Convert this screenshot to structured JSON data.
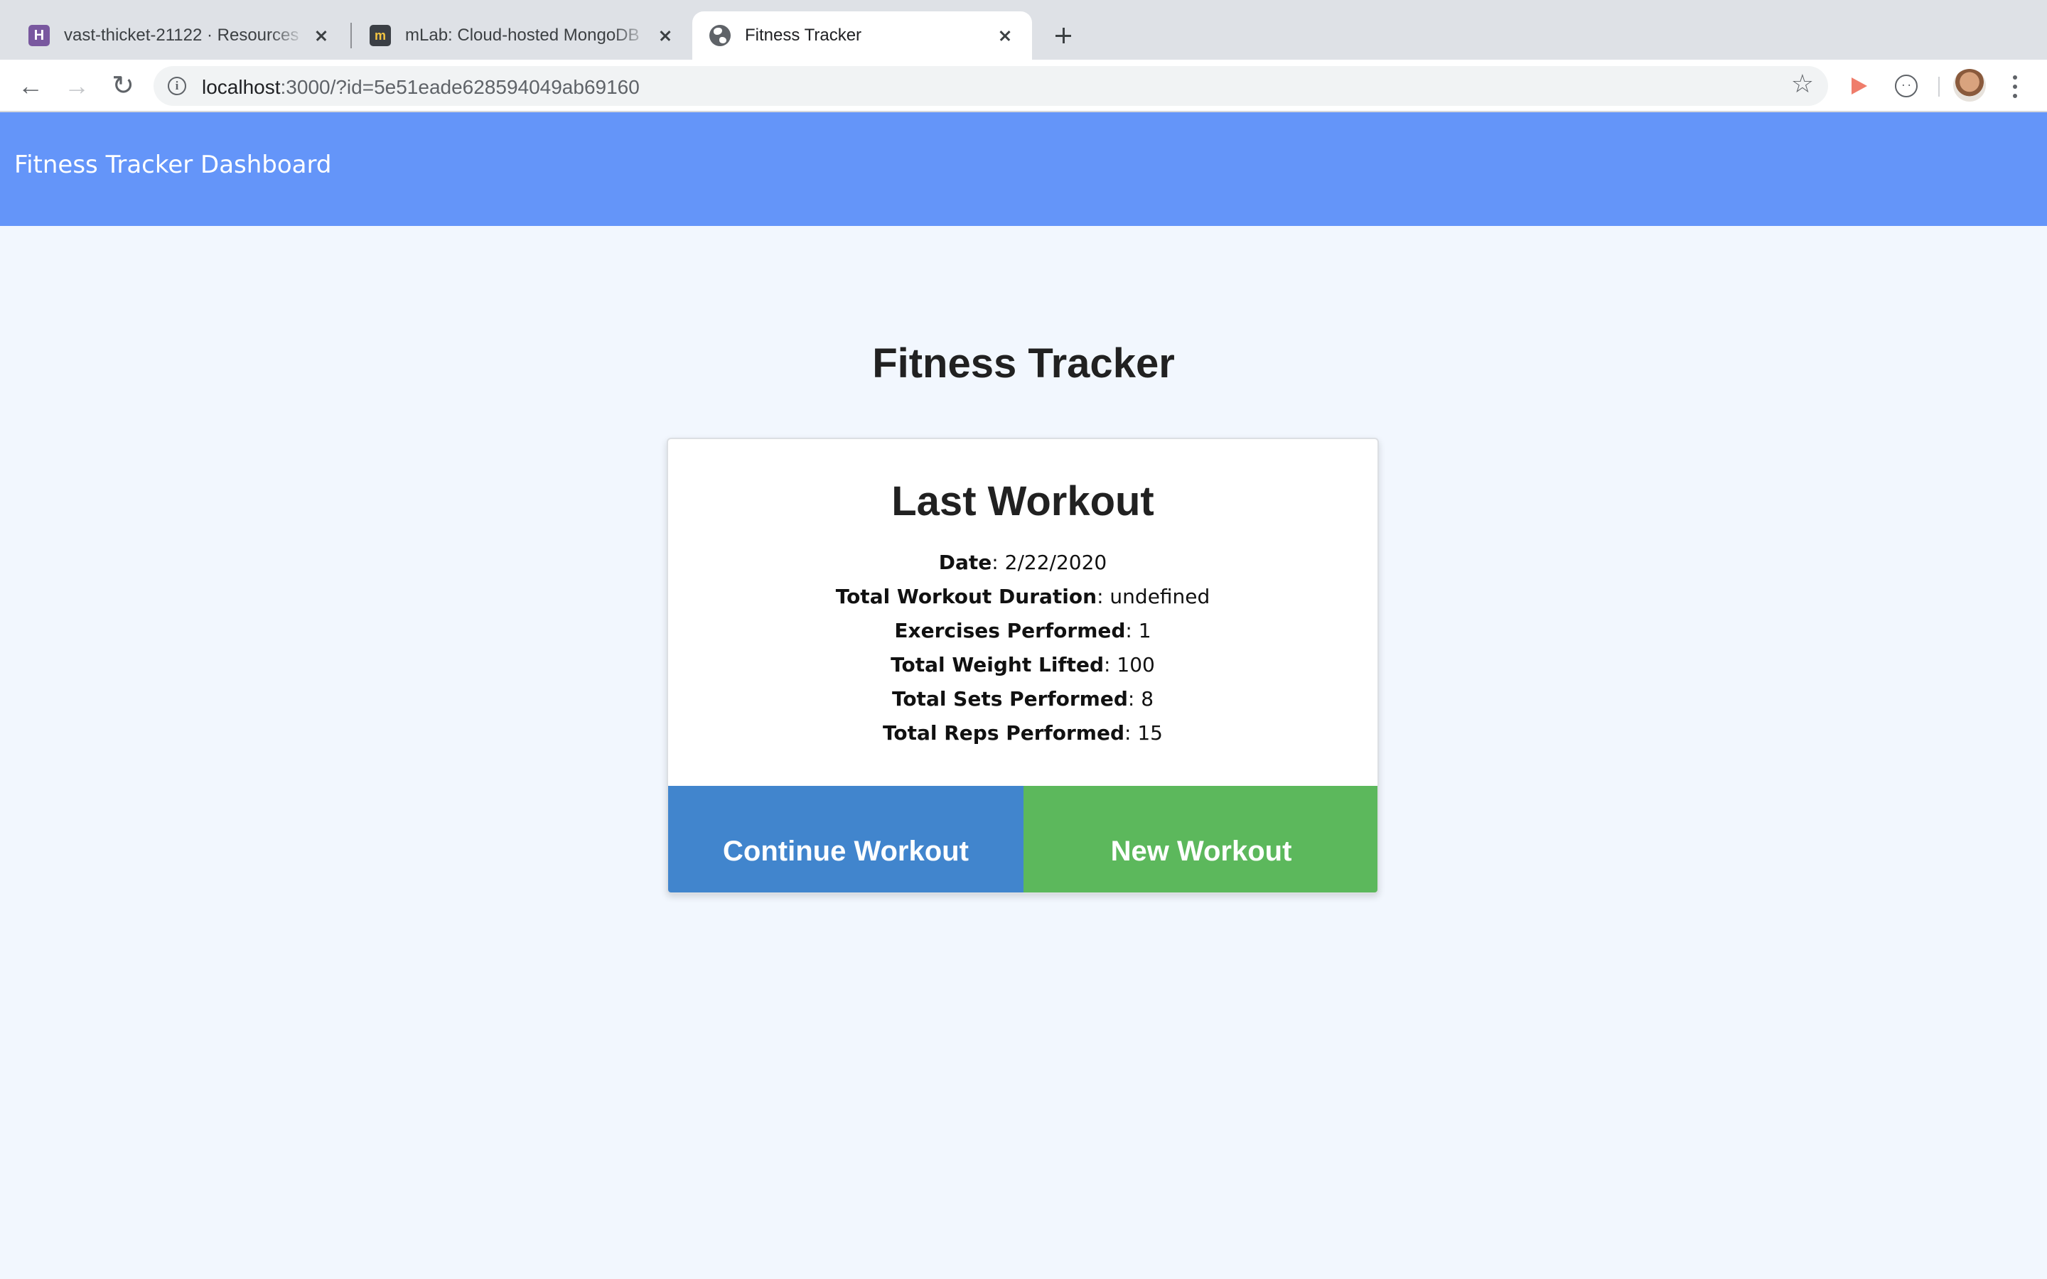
{
  "browser": {
    "tabs": [
      {
        "title": "vast-thicket-21122 · Resources",
        "icon": "heroku-icon",
        "active": false
      },
      {
        "title": "mLab: Cloud-hosted MongoDB",
        "icon": "mlab-icon",
        "active": false
      },
      {
        "title": "Fitness Tracker",
        "icon": "globe-icon",
        "active": true
      }
    ],
    "url_host": "localhost",
    "url_rest": ":3000/?id=5e51eade628594049ab69160",
    "favicons": {
      "heroku": "H",
      "mlab": "m"
    }
  },
  "navbar": {
    "brand": "Fitness Tracker Dashboard",
    "color": "#6495f9"
  },
  "page": {
    "title": "Fitness Tracker",
    "background": "#f2f7fe"
  },
  "last_workout": {
    "title": "Last Workout",
    "stats": [
      {
        "label": "Date",
        "sep": ": ",
        "value": "2/22/2020"
      },
      {
        "label": "Total Workout Duration",
        "sep": ": ",
        "value": "undefined"
      },
      {
        "label": "Exercises Performed",
        "sep": ": ",
        "value": "1"
      },
      {
        "label": "Total Weight Lifted",
        "sep": ": ",
        "value": "100"
      },
      {
        "label": "Total Sets Performed",
        "sep": ": ",
        "value": "8"
      },
      {
        "label": "Total Reps Performed",
        "sep": ": ",
        "value": "15"
      }
    ],
    "buttons": {
      "continue": {
        "label": "Continue Workout",
        "color": "#4185cd"
      },
      "new": {
        "label": "New Workout",
        "color": "#5cb85c"
      }
    }
  }
}
